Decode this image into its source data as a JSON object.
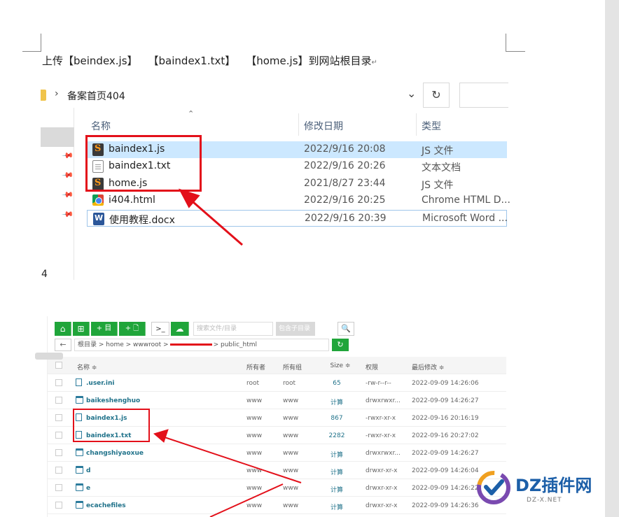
{
  "doc": {
    "instruction": "上传【beindex.js】　　【baindex1.txt】　　【home.js】到网站根目录",
    "para_mark": "↵",
    "side_text": "4"
  },
  "explorer": {
    "path": "备案首页404",
    "separator": "›",
    "dropdown_icon": "chevron-down-icon",
    "refresh_icon": "↻",
    "columns": {
      "name": "名称",
      "date": "修改日期",
      "type": "类型"
    },
    "files": [
      {
        "name": "baindex1.js",
        "date": "2022/9/16 20:08",
        "type": "JS 文件",
        "icon": "sublime-icon",
        "selected": true
      },
      {
        "name": "baindex1.txt",
        "date": "2022/9/16 20:26",
        "type": "文本文档",
        "icon": "text-file-icon",
        "selected": false
      },
      {
        "name": "home.js",
        "date": "2021/8/27 23:44",
        "type": "JS 文件",
        "icon": "sublime-icon",
        "selected": false
      },
      {
        "name": "i404.html",
        "date": "2022/9/16 20:25",
        "type": "Chrome HTML D...",
        "icon": "chrome-icon",
        "selected": false
      },
      {
        "name": "使用教程.docx",
        "date": "2022/9/16 20:39",
        "type": "Microsoft Word ...",
        "icon": "word-icon",
        "selected": false
      }
    ]
  },
  "panel": {
    "toolbar": {
      "home_icon": "⌂",
      "share_icon": "⊞",
      "new_dir": "+ 目",
      "new_file": "+ 🗋",
      "terminal": ">_",
      "upload_icon": "☁",
      "search_placeholder": "搜索文件/目录",
      "include_sub": "包含子目录",
      "search_icon": "🔍"
    },
    "back_icon": "←",
    "crumb_start": "根目录 > home > wwwroot >",
    "crumb_end": "> public_html",
    "refresh_icon": "↻",
    "headers": {
      "name": "名称 ≑",
      "owner": "所有者",
      "group": "所有组",
      "size": "Size ≑",
      "perm": "权限",
      "modified": "最后修改 ≑"
    },
    "rows": [
      {
        "name": ".user.ini",
        "kind": "file",
        "owner": "root",
        "group": "root",
        "size": "65",
        "perm": "-rw-r--r--",
        "modified": "2022-09-09 14:26:06"
      },
      {
        "name": "baikeshenghuo",
        "kind": "folder",
        "owner": "www",
        "group": "www",
        "size": "计算",
        "perm": "drwxrwxr...",
        "modified": "2022-09-09 14:26:27"
      },
      {
        "name": "baindex1.js",
        "kind": "file",
        "owner": "www",
        "group": "www",
        "size": "867",
        "perm": "-rwxr-xr-x",
        "modified": "2022-09-16 20:16:19"
      },
      {
        "name": "baindex1.txt",
        "kind": "file",
        "owner": "www",
        "group": "www",
        "size": "2282",
        "perm": "-rwxr-xr-x",
        "modified": "2022-09-16 20:27:02"
      },
      {
        "name": "changshiyaoxue",
        "kind": "folder",
        "owner": "www",
        "group": "www",
        "size": "计算",
        "perm": "drwxrwxr...",
        "modified": "2022-09-09 14:26:27"
      },
      {
        "name": "d",
        "kind": "folder",
        "owner": "www",
        "group": "www",
        "size": "计算",
        "perm": "drwxr-xr-x",
        "modified": "2022-09-09 14:26:04"
      },
      {
        "name": "e",
        "kind": "folder",
        "owner": "www",
        "group": "www",
        "size": "计算",
        "perm": "drwxr-xr-x",
        "modified": "2022-09-09 14:26:22"
      },
      {
        "name": "ecachefiles",
        "kind": "folder",
        "owner": "www",
        "group": "www",
        "size": "计算",
        "perm": "drwxr-xr-x",
        "modified": "2022-09-09 14:26:36"
      }
    ]
  },
  "watermark": {
    "brand": "DZ插件网",
    "url": "DZ-X.NET",
    "brand_colors": [
      "#f0a020",
      "#1c5fa8",
      "#7a4ab0"
    ]
  },
  "annotation_color": "#e3101a"
}
